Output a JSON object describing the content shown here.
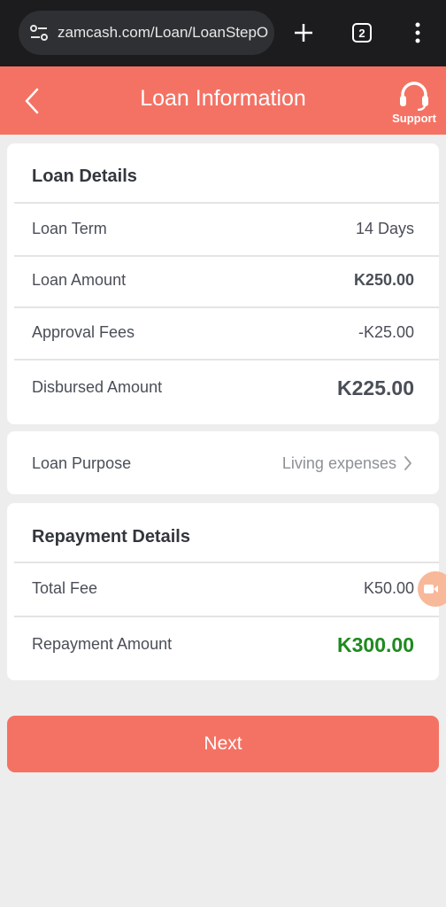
{
  "browser": {
    "url": "zamcash.com/Loan/LoanStepO",
    "tab_count": "2"
  },
  "header": {
    "title": "Loan Information",
    "support_label": "Support"
  },
  "loan_details": {
    "title": "Loan Details",
    "rows": [
      {
        "label": "Loan Term",
        "value": "14 Days"
      },
      {
        "label": "Loan Amount",
        "value": "K250.00"
      },
      {
        "label": "Approval Fees",
        "value": "-K25.00"
      },
      {
        "label": "Disbursed Amount",
        "value": "K225.00"
      }
    ]
  },
  "loan_purpose": {
    "label": "Loan Purpose",
    "value": "Living expenses"
  },
  "repayment_details": {
    "title": "Repayment Details",
    "rows": [
      {
        "label": "Total Fee",
        "value": "K50.00"
      },
      {
        "label": "Repayment Amount",
        "value": "K300.00"
      }
    ]
  },
  "actions": {
    "next_label": "Next"
  },
  "colors": {
    "brand": "#f47264",
    "repayment_amount": "#1f8a1f"
  }
}
